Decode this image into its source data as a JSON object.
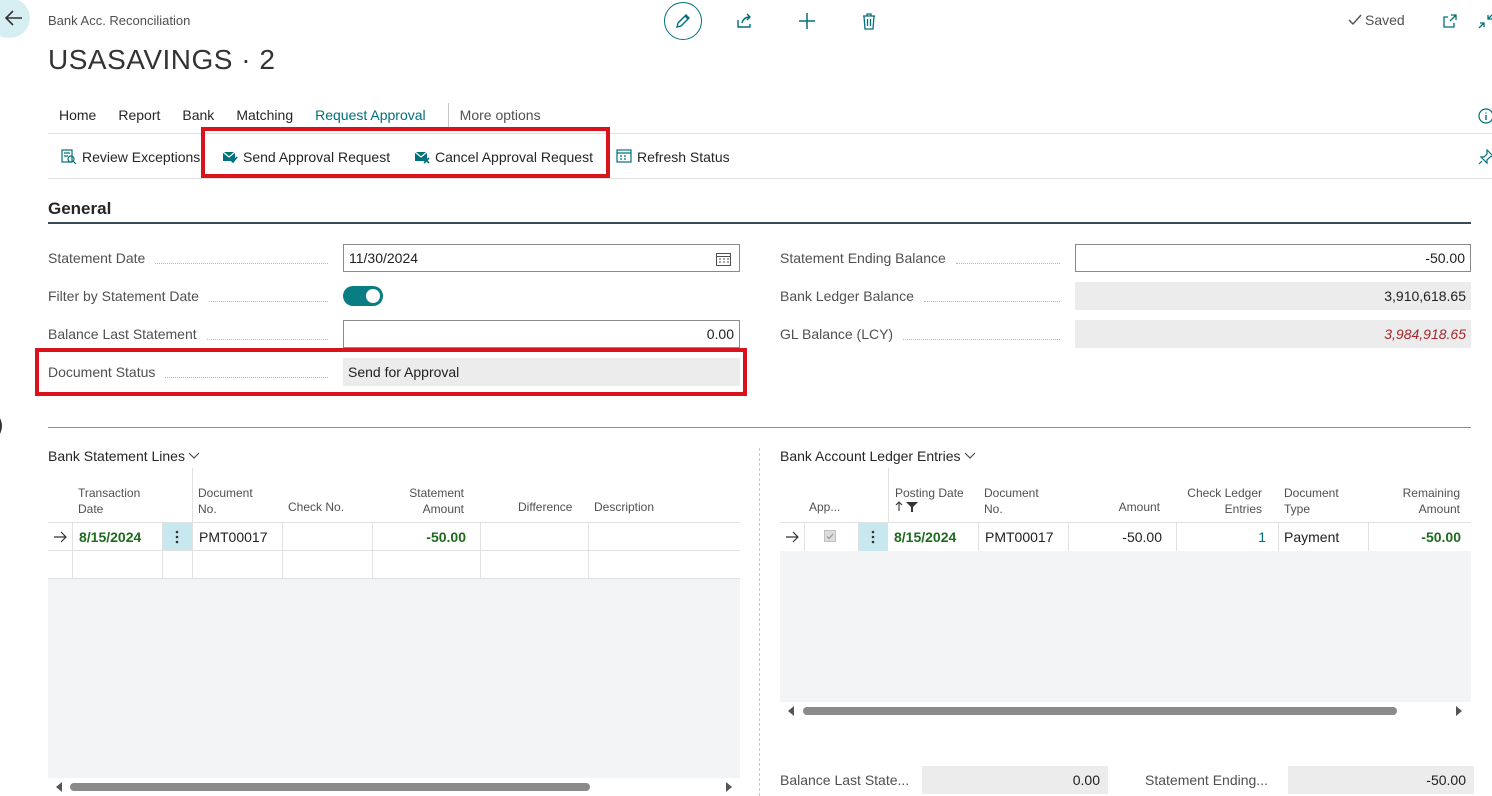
{
  "header": {
    "breadcrumb": "Bank Acc. Reconciliation",
    "title": "USASAVINGS · 2",
    "saved_label": "Saved"
  },
  "tabs": [
    "Home",
    "Report",
    "Bank",
    "Matching",
    "Request Approval"
  ],
  "tabs_more": "More options",
  "active_tab": "Request Approval",
  "actions": {
    "review_exceptions": "Review Exceptions",
    "send_approval": "Send Approval Request",
    "cancel_approval": "Cancel Approval Request",
    "refresh_status": "Refresh Status"
  },
  "general": {
    "title": "General",
    "statement_date_label": "Statement Date",
    "statement_date": "11/30/2024",
    "filter_label": "Filter by Statement Date",
    "filter_on": true,
    "balance_last_label": "Balance Last Statement",
    "balance_last": "0.00",
    "doc_status_label": "Document Status",
    "doc_status": "Send for Approval",
    "stmt_ending_label": "Statement Ending Balance",
    "stmt_ending": "-50.00",
    "bank_ledger_label": "Bank Ledger Balance",
    "bank_ledger": "3,910,618.65",
    "gl_balance_label": "GL Balance (LCY)",
    "gl_balance": "3,984,918.65"
  },
  "statement_lines": {
    "title": "Bank Statement Lines",
    "headers": {
      "transaction_date": [
        "Transaction",
        "Date"
      ],
      "document_no": [
        "Document",
        "No."
      ],
      "check_no": "Check No.",
      "statement_amount": [
        "Statement",
        "Amount"
      ],
      "difference": "Difference",
      "description": "Description"
    },
    "row": {
      "transaction_date": "8/15/2024",
      "document_no": "PMT00017",
      "check_no": "",
      "statement_amount": "-50.00",
      "difference": "",
      "description": ""
    }
  },
  "ledger_entries": {
    "title": "Bank Account Ledger Entries",
    "headers": {
      "applied": "App...",
      "posting_date": "Posting Date",
      "document_no": [
        "Document",
        "No."
      ],
      "amount": "Amount",
      "check_ledger": [
        "Check Ledger",
        "Entries"
      ],
      "document_type": [
        "Document",
        "Type"
      ],
      "remaining": [
        "Remaining",
        "Amount"
      ]
    },
    "row": {
      "applied": true,
      "posting_date": "8/15/2024",
      "document_no": "PMT00017",
      "amount": "-50.00",
      "check_ledger": "1",
      "document_type": "Payment",
      "remaining": "-50.00"
    }
  },
  "footer": {
    "balance_last_label": "Balance Last State...",
    "balance_last": "0.00",
    "stmt_ending_label": "Statement Ending...",
    "stmt_ending": "-50.00"
  },
  "colors": {
    "accent": "#00707a",
    "highlight_box": "#d9121b",
    "positive_bold": "#1e6b1e",
    "gl_italic": "#a4262c"
  }
}
